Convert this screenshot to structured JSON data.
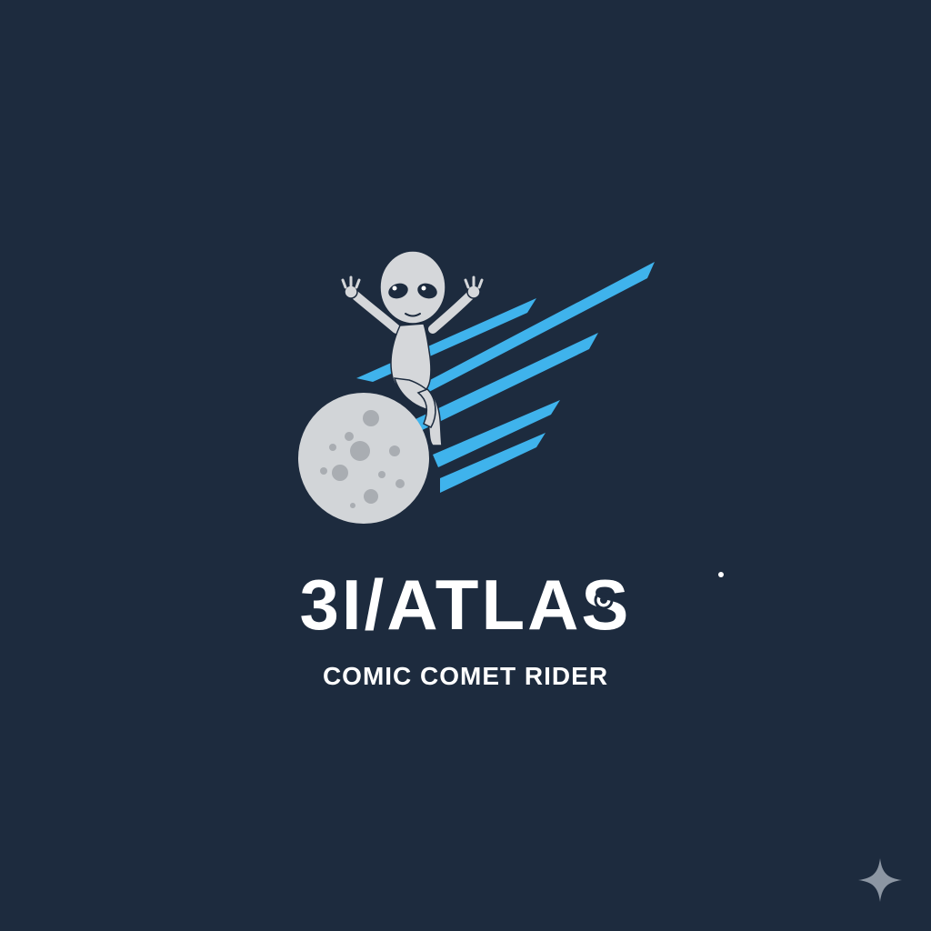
{
  "logo": {
    "title": "3I/ATLAS",
    "tagline": "COMIC COMET RIDER"
  },
  "colors": {
    "background": "#1d2b3e",
    "streak_blue": "#3fb3ec",
    "moon_gray": "#d2d5d8",
    "crater_gray": "#a9adb2",
    "alien_gray": "#d5d7da",
    "text_white": "#ffffff"
  },
  "icons": {
    "corner": "sparkle-icon"
  }
}
